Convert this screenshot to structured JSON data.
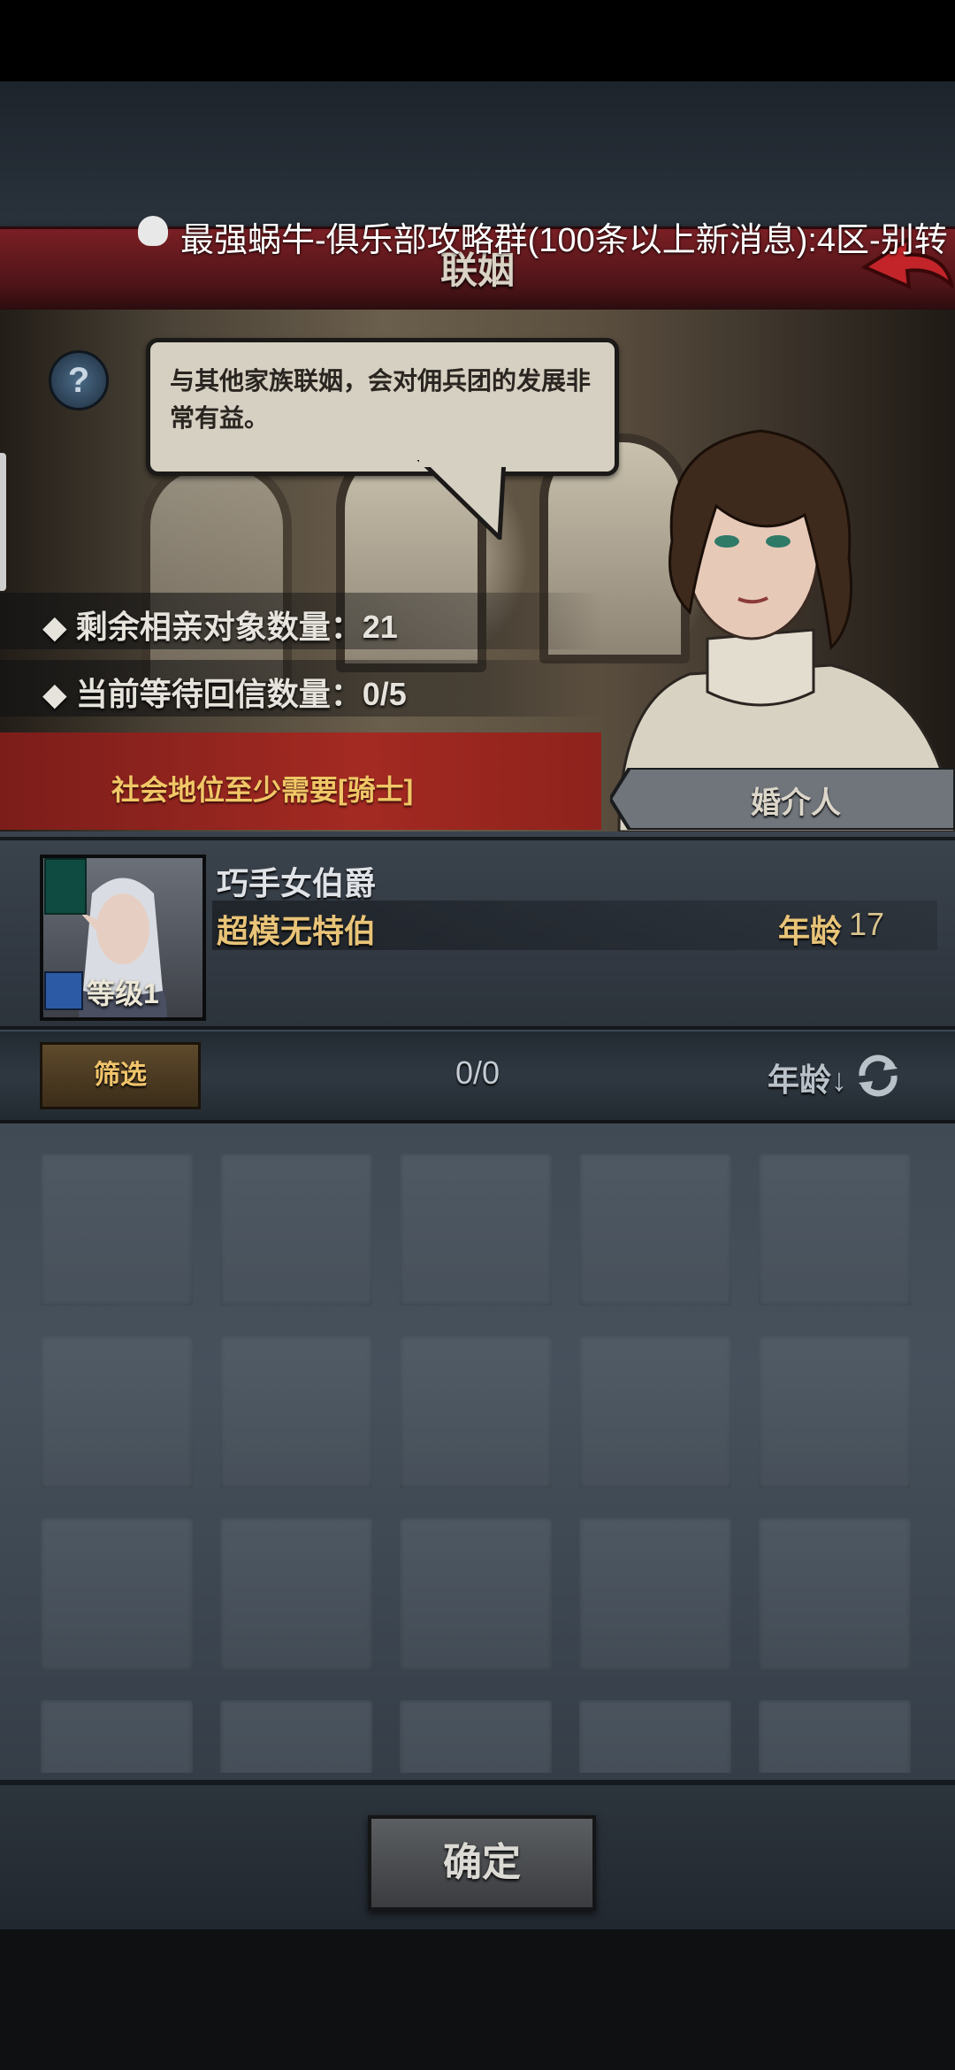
{
  "header": {
    "title": "联姻"
  },
  "notification": {
    "text": "最强蜗牛-俱乐部攻略群(100条以上新消息):4区-别转"
  },
  "scene": {
    "help_symbol": "?",
    "speech": "与其他家族联姻，会对佣兵团的发展非常有益。",
    "stats": [
      {
        "label": "剩余相亲对象数量",
        "value": "21"
      },
      {
        "label": "当前等待回信数量",
        "value": "0/5"
      }
    ],
    "requirement": "社会地位至少需要[骑士]",
    "matchmaker_label": "婚介人"
  },
  "character": {
    "name": "巧手女伯爵",
    "title": "超模无特伯",
    "age_label": "年龄",
    "age": "17",
    "level_label": "等级1"
  },
  "filter": {
    "button_label": "筛选",
    "count": "0/0",
    "sort_label": "年龄↓"
  },
  "footer": {
    "confirm_label": "确定"
  },
  "icons": [
    "help-icon",
    "back-arrow-icon",
    "notification-bell-icon",
    "refresh-icon",
    "sword-icon",
    "crest-icon"
  ],
  "colors": {
    "title_band": "#7a1f24",
    "requirement_text": "#f0c766",
    "gold_text": "#e9c478"
  }
}
